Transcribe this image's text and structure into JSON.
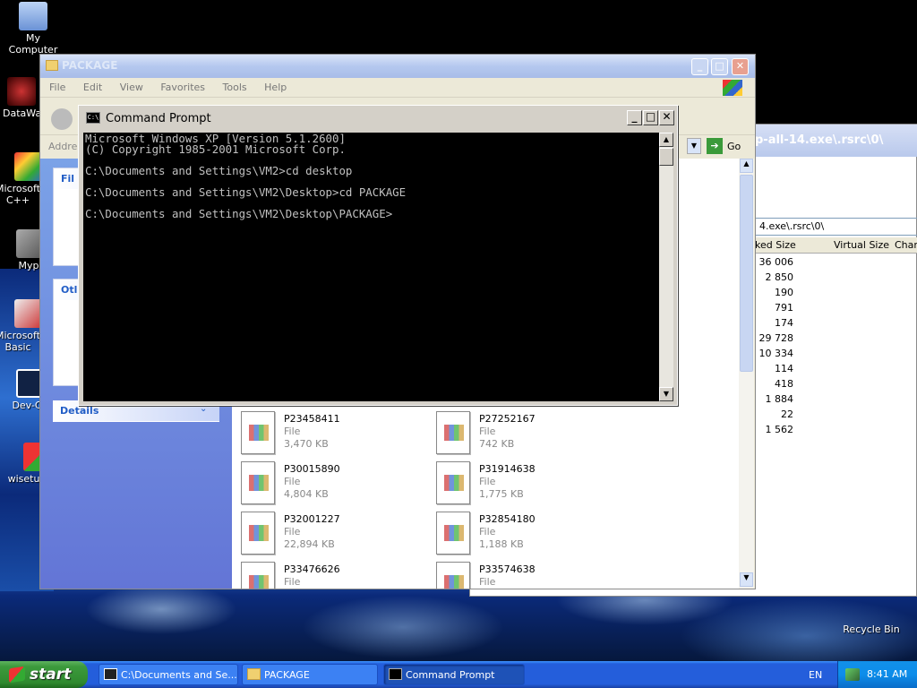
{
  "desktop": {
    "icons": [
      {
        "label": "My Computer"
      },
      {
        "label": "DataWa"
      },
      {
        "label": "Microsoft C++"
      },
      {
        "label": "Myp"
      },
      {
        "label": "Microsoft Basic"
      },
      {
        "label": "Dev-C"
      },
      {
        "label": "wisetup"
      },
      {
        "label": "Recycle Bin"
      }
    ]
  },
  "explorer": {
    "title": "PACKAGE",
    "menu": [
      "File",
      "Edit",
      "View",
      "Favorites",
      "Tools",
      "Help"
    ],
    "address_label": "Addres",
    "go_label": "Go",
    "taskpane": {
      "file_box_head": "Fil",
      "other_box_head": "Otl",
      "details_head": "Details"
    },
    "files": [
      {
        "name": "P23458411",
        "type": "File",
        "size": "3,470 KB"
      },
      {
        "name": "P27252167",
        "type": "File",
        "size": "742 KB"
      },
      {
        "name": "P30015890",
        "type": "File",
        "size": "4,804 KB"
      },
      {
        "name": "P31914638",
        "type": "File",
        "size": "1,775 KB"
      },
      {
        "name": "P32001227",
        "type": "File",
        "size": "22,894 KB"
      },
      {
        "name": "P32854180",
        "type": "File",
        "size": "1,188 KB"
      },
      {
        "name": "P33476626",
        "type": "File",
        "size": ""
      },
      {
        "name": "P33574638",
        "type": "File",
        "size": ""
      }
    ]
  },
  "background_window": {
    "path_title": "p-all-14.exe\\.rsrc\\0\\",
    "path_bar": "4.exe\\.rsrc\\0\\",
    "columns": [
      "ked Size",
      "Virtual Size",
      "Chara"
    ],
    "values": [
      "36 006",
      "2 850",
      "190 791",
      "174",
      "29 728",
      "10 334",
      "114 418",
      "1 884",
      "22",
      "1 562"
    ]
  },
  "cmd": {
    "title": "Command Prompt",
    "icon_text": "C:\\",
    "lines": [
      "Microsoft Windows XP [Version 5.1.2600]",
      "(C) Copyright 1985-2001 Microsoft Corp.",
      "",
      "C:\\Documents and Settings\\VM2>cd desktop",
      "",
      "C:\\Documents and Settings\\VM2\\Desktop>cd PACKAGE",
      "",
      "C:\\Documents and Settings\\VM2\\Desktop\\PACKAGE>"
    ]
  },
  "taskbar": {
    "start_label": "start",
    "tasks": [
      {
        "label": "C:\\Documents and Se...",
        "active": false
      },
      {
        "label": "PACKAGE",
        "active": false
      },
      {
        "label": "Command Prompt",
        "active": true
      }
    ],
    "lang": "EN",
    "clock": "8:41 AM"
  },
  "colors": {
    "xp_blue": "#245edb",
    "start_green": "#3c9a3c",
    "console_bg": "#000000",
    "console_fg": "#c0c0c0"
  }
}
